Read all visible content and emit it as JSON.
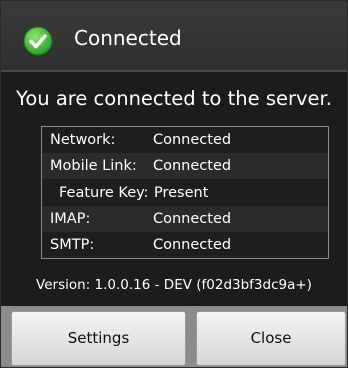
{
  "dialog": {
    "title": "Connected",
    "title_icon": "check-circle-icon",
    "message": "You are connected to the server.",
    "status_rows": [
      {
        "key": "Network:",
        "value": "Connected"
      },
      {
        "key": "Mobile Link:",
        "value": "Connected"
      },
      {
        "key": "Feature Key:",
        "value": "Present"
      },
      {
        "key": "IMAP:",
        "value": "Connected"
      },
      {
        "key": "SMTP:",
        "value": "Connected"
      }
    ],
    "version": "Version: 1.0.0.16 - DEV (f02d3bf3dc9a+)",
    "buttons": {
      "settings_label": "Settings",
      "close_label": "Close"
    }
  },
  "colors": {
    "background": "#1c1c1c",
    "check_green": "#3fb83f",
    "text": "#ffffff",
    "button_bar": "#8c8c8c"
  }
}
